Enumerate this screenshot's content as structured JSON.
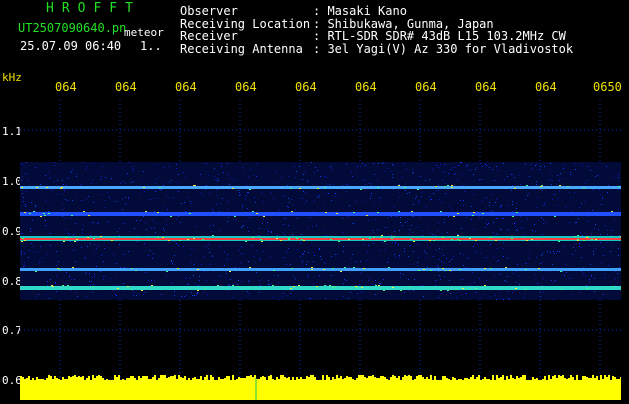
{
  "header": {
    "brand": "HROFFT",
    "filename": "UT2507090640.pn",
    "mode": "meteor",
    "timestamp": "25.07.09 06:40",
    "count": "1.."
  },
  "info": {
    "rows": [
      {
        "label": "Observer",
        "value": "Masaki Kano"
      },
      {
        "label": "Receiving Location",
        "value": "Shibukawa, Gunma, Japan"
      },
      {
        "label": "Receiver",
        "value": "RTL-SDR SDR# 43dB L15 103.2MHz CW"
      },
      {
        "label": "Receiving Antenna",
        "value": "3el Yagi(V) Az 330 for Vladivostok"
      }
    ]
  },
  "axis": {
    "unit": "kHz",
    "time_ticks": [
      "064",
      "064",
      "064",
      "064",
      "064",
      "064",
      "064",
      "064",
      "064",
      "0650"
    ],
    "freq_ticks": [
      "1.1",
      "1.0",
      "0.9",
      "0.8",
      "0.7",
      "0.6"
    ]
  },
  "colors": {
    "grid": "#0030c0",
    "text_green": "#22e022",
    "tick_yellow": "#f0e000",
    "noise_yellow": "#ffff00"
  }
}
